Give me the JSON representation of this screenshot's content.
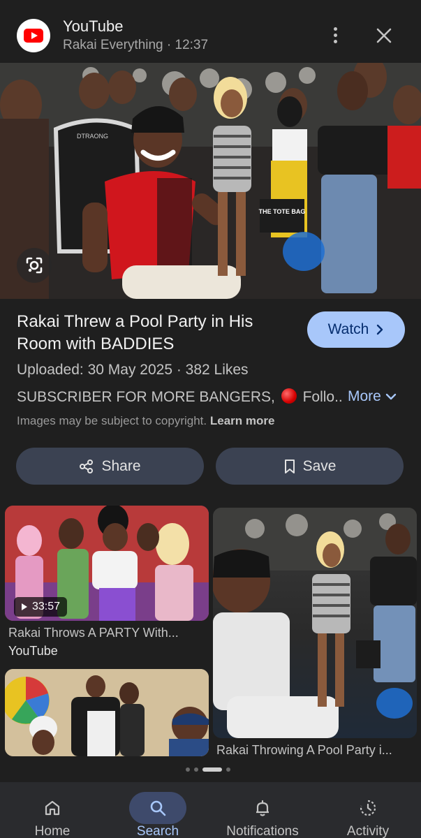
{
  "header": {
    "source_name": "YouTube",
    "source_meta": "Rakai Everything · 12:37"
  },
  "result": {
    "title": "Rakai Threw a Pool Party in His Room with BADDIES",
    "watch_label": "Watch",
    "uploaded": "Uploaded: 30 May 2025 · 382 Likes",
    "description_start": "SUBSCRIBER FOR MORE BANGERS,",
    "description_end": "Follo...",
    "more_label": "More",
    "copyright_text": "Images may be subject to copyright.",
    "learn_more": "Learn more",
    "hero_image_text": "THE TOTE BAG",
    "chair_brand": "DTRAONG"
  },
  "actions": {
    "share_label": "Share",
    "save_label": "Save"
  },
  "related": [
    {
      "title": "Rakai Throws A PARTY With...",
      "source": "YouTube",
      "duration": "33:57"
    },
    {
      "title": "Rakai Throwing A Pool Party i..."
    },
    {
      "title": ""
    }
  ],
  "nav": [
    {
      "label": "Home",
      "icon": "home-icon"
    },
    {
      "label": "Search",
      "icon": "search-icon",
      "active": true
    },
    {
      "label": "Notifications",
      "icon": "bell-icon"
    },
    {
      "label": "Activity",
      "icon": "activity-icon"
    }
  ],
  "colors": {
    "background": "#1f1f1f",
    "accent": "#a8c7fa",
    "button_bg": "#3b4252",
    "nav_bg": "#2a2b2e"
  }
}
